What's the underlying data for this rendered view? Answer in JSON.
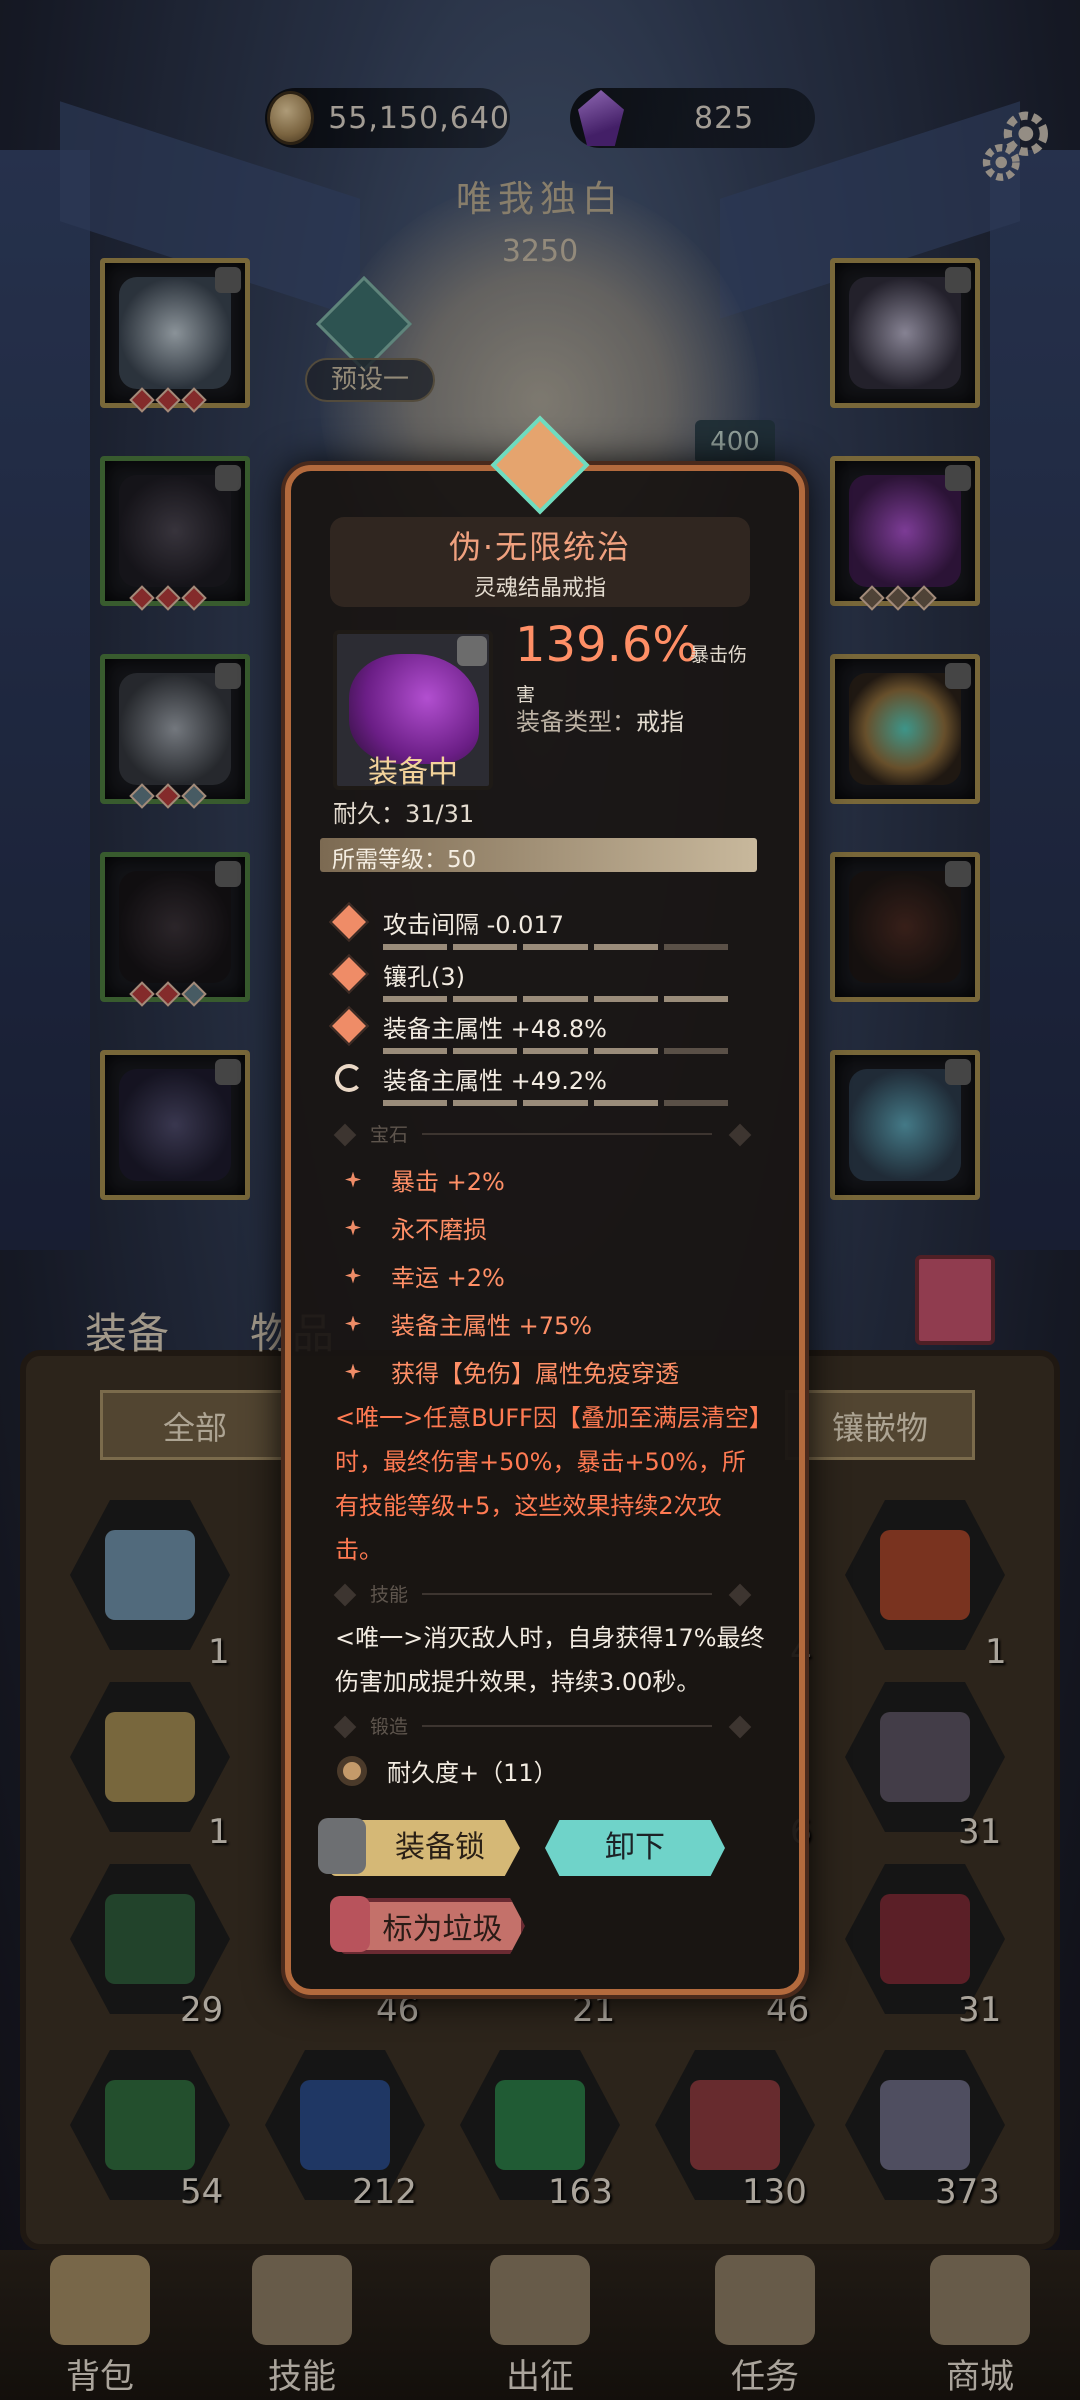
{
  "currency": {
    "gold": "55,150,640",
    "gems": "825"
  },
  "rank": {
    "name": "唯我独白",
    "score": "3250",
    "preset": "预设一",
    "level_badge": "400"
  },
  "bag": {
    "tab_equip": "装备",
    "tab_items": "物品",
    "filter_all": "全部",
    "filter_inlay": "镶嵌物",
    "counts": [
      "1",
      "4",
      "1",
      "1",
      "6",
      "31",
      "29",
      "46",
      "21",
      "46",
      "31",
      "54",
      "212",
      "163",
      "130",
      "373"
    ]
  },
  "popup": {
    "name": "伪·无限统治",
    "subtitle": "灵魂结晶戒指",
    "main_value": "139.6%",
    "main_label_a": "暴击伤",
    "main_label_b": "害",
    "equip_type": "装备类型：",
    "equip_type_value": "戒指",
    "equipped": "装备中",
    "durability": "耐久：31/31",
    "required_level": "所需等级：50",
    "attributes": [
      "攻击间隔 -0.017",
      "镶孔(3)",
      "装备主属性 +48.8%",
      "装备主属性 +49.2%"
    ],
    "section_gem": "宝石",
    "gems": [
      "暴击 +2%",
      "永不磨损",
      "幸运 +2%",
      "装备主属性 +75%",
      "获得【免伤】属性免疫穿透"
    ],
    "unique_1": "<唯一>任意BUFF因【叠加至满层清空】时，最终伤害+50%，暴击+50%，所有技能等级+5，这些效果持续2次攻击。",
    "section_skill": "技能",
    "unique_2": "<唯一>消灭敌人时，自身获得17%最终伤害加成提升效果，持续3.00秒。",
    "section_forge": "锻造",
    "forge": "耐久度+（11）",
    "btn_lock": "装备锁",
    "btn_unequip": "卸下",
    "btn_trash": "标为垃圾"
  },
  "nav": [
    "背包",
    "技能",
    "出征",
    "任务",
    "商城"
  ],
  "colors": {
    "accent_orange": "#ff8f66",
    "teal": "#6fd3c9",
    "gold": "#d5b876"
  }
}
